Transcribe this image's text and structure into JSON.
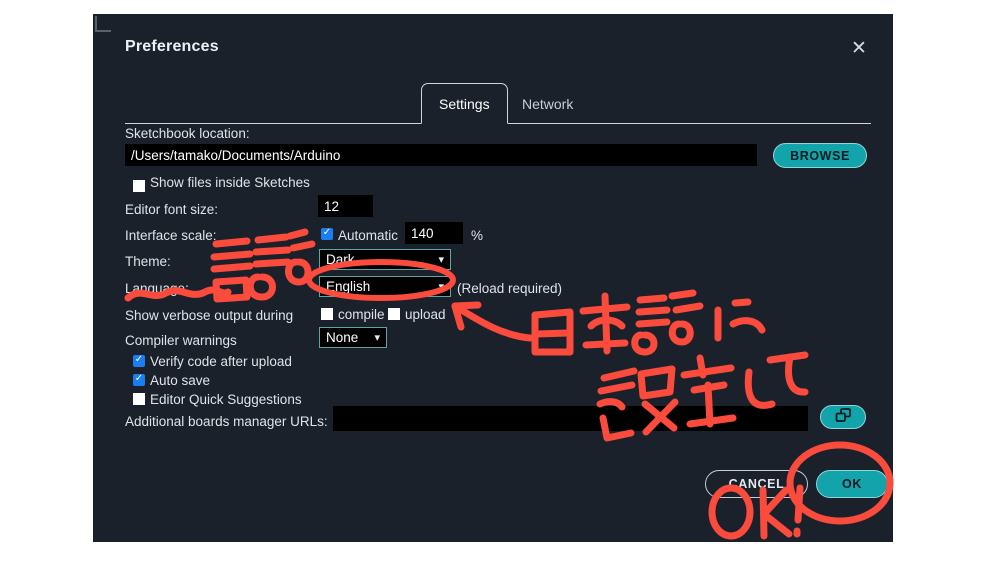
{
  "dialog": {
    "title": "Preferences",
    "close_icon": "close-icon",
    "tabs": [
      {
        "label": "Settings",
        "active": true
      },
      {
        "label": "Network",
        "active": false
      }
    ]
  },
  "settings": {
    "sketchbook_label": "Sketchbook location:",
    "sketchbook_path": "/Users/tamako/Documents/Arduino",
    "browse_label": "BROWSE",
    "show_files_label": "Show files inside Sketches",
    "show_files_checked": false,
    "editor_font_label": "Editor font size:",
    "editor_font_value": "12",
    "interface_scale_label": "Interface scale:",
    "automatic_label": "Automatic",
    "automatic_checked": true,
    "scale_value": "140",
    "percent_symbol": "%",
    "theme_label": "Theme:",
    "theme_value": "Dark",
    "language_label": "Language:",
    "language_value": "English",
    "reload_note": "(Reload required)",
    "verbose_label": "Show verbose output during",
    "compile_label": "compile",
    "compile_checked": false,
    "upload_label": "upload",
    "upload_checked": false,
    "compiler_warnings_label": "Compiler warnings",
    "compiler_warnings_value": "None",
    "verify_label": "Verify code after upload",
    "verify_checked": true,
    "autosave_label": "Auto save",
    "autosave_checked": true,
    "quick_suggestions_label": "Editor Quick Suggestions",
    "quick_suggestions_checked": false,
    "boards_urls_label": "Additional boards manager URLs:",
    "boards_urls_value": "",
    "boards_urls_expand_icon": "expand-windows-icon"
  },
  "footer": {
    "cancel_label": "CANCEL",
    "ok_label": "OK"
  },
  "annotations": {
    "ink_color": "#fa4b3c",
    "note_language_word": "言語",
    "note_instruction_line1": "日本語に",
    "note_instruction_line2": "設定して、",
    "note_ok": "OK!",
    "marks": [
      "squiggle-under-show-verbose",
      "ellipse-around-language-dropdown",
      "arrow-to-language-dropdown",
      "circle-around-ok-button"
    ]
  },
  "colors": {
    "dialog_bg": "#1a212b",
    "field_bg": "#000000",
    "accent_teal": "#12a3ab",
    "select_border": "#5aa7a5",
    "checkbox_on": "#1a7ef0",
    "text": "#dfe3e8"
  }
}
